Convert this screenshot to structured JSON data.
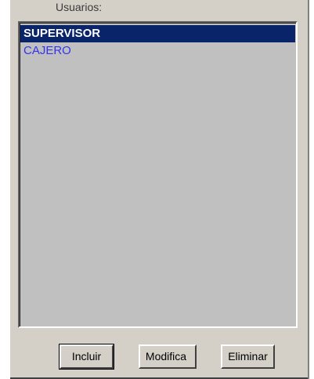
{
  "group": {
    "label": "Usuarios:"
  },
  "users": {
    "items": [
      {
        "label": "SUPERVISOR",
        "selected": true
      },
      {
        "label": "CAJERO",
        "selected": false
      }
    ]
  },
  "buttons": {
    "incluir": "Incluir",
    "modifica": "Modifica",
    "eliminar": "Eliminar"
  },
  "colors": {
    "selection_bg": "#0a246a",
    "item_text": "#3333ee",
    "panel_bg": "#d4d0c8",
    "list_bg": "#c0c0c0"
  }
}
